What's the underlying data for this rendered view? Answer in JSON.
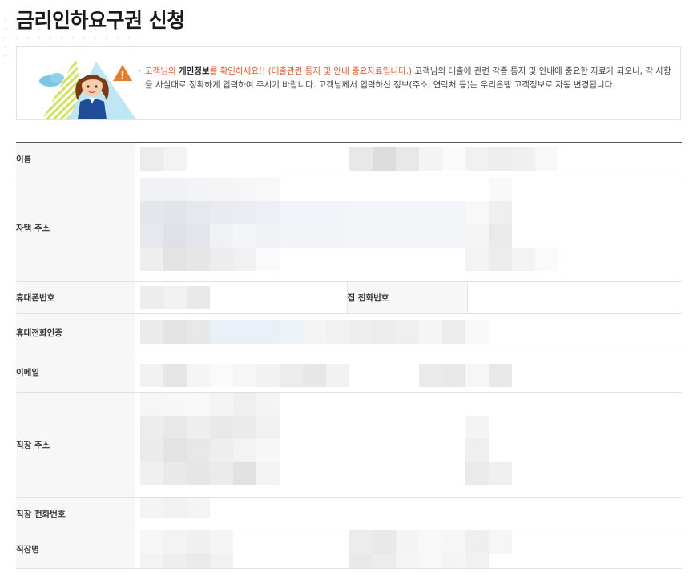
{
  "page": {
    "title": "금리인하요구권 신청"
  },
  "notice": {
    "part1": "고객님의 ",
    "part2": "개인정보",
    "part3": "를 확인하세요!! (대출관련 통지 및 안내 중요자료입니다.)",
    "part4": " 고객님의 대출에 관련 각종 통지 및 안내에 중요한 자료가 되오니, 각 사항을 사실대로 정확하게 입력하여 주시기 바랍니다. 고객님께서 입력하신 정보(주소, 연락처 등)는 우리은행 고객정보로 자동 변경됩니다."
  },
  "form": {
    "name_label": "이름",
    "home_address_label": "자택 주소",
    "mobile_label": "휴대폰번호",
    "home_phone_label": "집 전화번호",
    "mobile_auth_label": "휴대전화인증",
    "email_label": "이메일",
    "work_address_label": "직장 주소",
    "work_phone_label": "직장 전화번호",
    "company_label": "직장명"
  },
  "colors": {
    "accent_red": "#e4572e",
    "header_border": "#555555",
    "label_bg": "#f7f7f7"
  }
}
